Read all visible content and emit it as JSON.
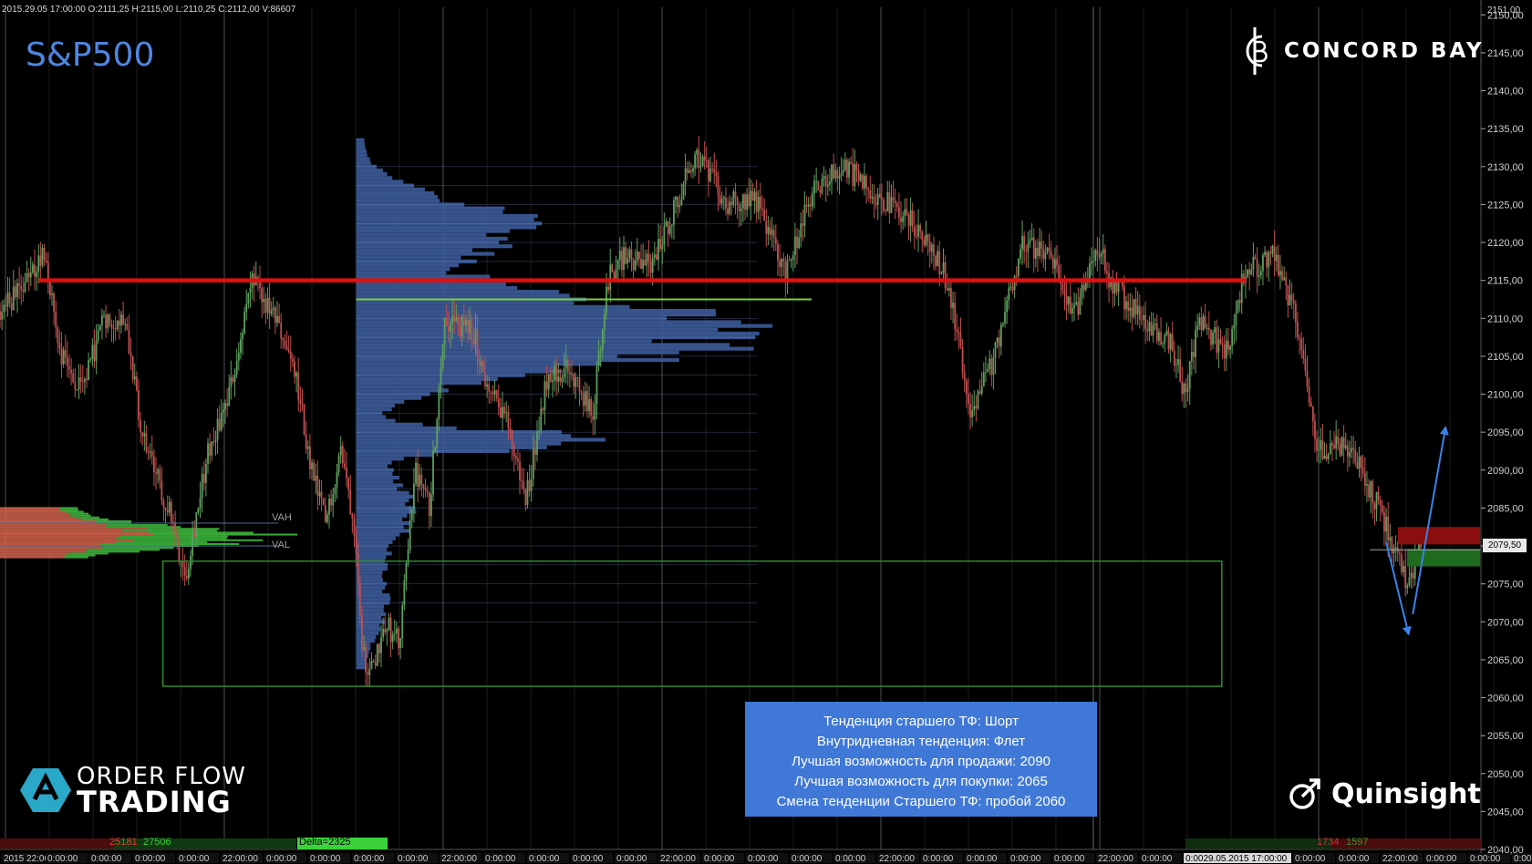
{
  "header": {
    "info_line": "2015.29.05 17:00:00   O:2111,25   H:2115,00   L:2110,25   C:2112,00   V:86607",
    "symbol": "S&P500"
  },
  "brand": {
    "top_right": "CONCORD BAY",
    "bottom_left_top": "ORDER FLOW",
    "bottom_left_bottom": "TRADING",
    "bottom_right": "Quinsight"
  },
  "analysis_box": {
    "lines": [
      "Тенденция старшего ТФ: Шорт",
      "Внутридневная тенденция: Флет",
      "Лучшая возможность для продажи:  2090",
      "Лучшая возможность для покупки:  2065",
      "Смена тенденции Старшего ТФ:  пробой 2060"
    ]
  },
  "price_tag": "2079,50",
  "bottom_stats": {
    "left_red": "25181",
    "left_green": "27506",
    "delta": "Delta=2325",
    "right_red": "1734",
    "right_green": "1597"
  },
  "labels": {
    "vah": "VAH",
    "val": "VAL"
  },
  "colors": {
    "background": "#000000",
    "candle_up": "#5fa05f",
    "candle_down": "#c05050",
    "profile": "#3d5c9a",
    "resistance": "#e01010",
    "poc": "#7ad03a",
    "box": "#2e8c2e",
    "arrow": "#3b82e8",
    "info_box": "#3f78d6",
    "title": "#4f86e0"
  },
  "chart_data": {
    "type": "candlestick",
    "title": "S&P500",
    "ylim": [
      2040,
      2151
    ],
    "y_ticks": [
      "2040,00",
      "2045,00",
      "2050,00",
      "2055,00",
      "2060,00",
      "2065,00",
      "2070,00",
      "2075,00",
      "2080,00",
      "2085,00",
      "2090,00",
      "2095,00",
      "2100,00",
      "2105,00",
      "2110,00",
      "2115,00",
      "2120,00",
      "2125,00",
      "2130,00",
      "2135,00",
      "2140,00",
      "2145,00",
      "2150,00"
    ],
    "top_tick": "2151,00",
    "x_ticks": [
      "2015 22:00:00",
      "0:00:00",
      "0:00:00",
      "0:00:00",
      "0:00:00",
      "22:00:00",
      "0:00:00",
      "0:00:00",
      "0:00:00",
      "0:00:00",
      "22:00:00",
      "0:00:00",
      "0:00:00",
      "0:00:00",
      "0:00:00",
      "22:00:00",
      "0:00:00",
      "0:00:00",
      "0:00:00",
      "0:00:00",
      "22:00:00",
      "0:00:00",
      "0:00:00",
      "0:00:00",
      "0:00:00",
      "22:00:00",
      "0:00:00",
      "0:0029.05.2015 17:00:00",
      "0:00:00",
      "0:00:00",
      "22:00:00",
      "0:00:00",
      "0:00:00",
      "0:00:00",
      "0:00:00",
      "22:00:00",
      "0:00:00"
    ],
    "price_path": [
      [
        0,
        2111
      ],
      [
        0.02,
        2115
      ],
      [
        0.03,
        2119
      ],
      [
        0.04,
        2106
      ],
      [
        0.055,
        2100
      ],
      [
        0.07,
        2110
      ],
      [
        0.085,
        2110
      ],
      [
        0.095,
        2095
      ],
      [
        0.115,
        2084
      ],
      [
        0.125,
        2076
      ],
      [
        0.14,
        2092
      ],
      [
        0.155,
        2100
      ],
      [
        0.17,
        2115
      ],
      [
        0.19,
        2108
      ],
      [
        0.2,
        2102
      ],
      [
        0.21,
        2090
      ],
      [
        0.22,
        2083
      ],
      [
        0.23,
        2093
      ],
      [
        0.24,
        2082
      ],
      [
        0.245,
        2066
      ],
      [
        0.25,
        2063
      ],
      [
        0.26,
        2070
      ],
      [
        0.27,
        2067
      ],
      [
        0.28,
        2090
      ],
      [
        0.29,
        2085
      ],
      [
        0.3,
        2110
      ],
      [
        0.32,
        2108
      ],
      [
        0.33,
        2100
      ],
      [
        0.34,
        2098
      ],
      [
        0.355,
        2086
      ],
      [
        0.37,
        2103
      ],
      [
        0.385,
        2103
      ],
      [
        0.4,
        2097
      ],
      [
        0.41,
        2115
      ],
      [
        0.42,
        2118
      ],
      [
        0.44,
        2117
      ],
      [
        0.47,
        2132
      ],
      [
        0.49,
        2125
      ],
      [
        0.51,
        2126
      ],
      [
        0.53,
        2116
      ],
      [
        0.55,
        2127
      ],
      [
        0.57,
        2130
      ],
      [
        0.6,
        2125
      ],
      [
        0.62,
        2122
      ],
      [
        0.64,
        2115
      ],
      [
        0.655,
        2098
      ],
      [
        0.67,
        2104
      ],
      [
        0.69,
        2120
      ],
      [
        0.71,
        2118
      ],
      [
        0.725,
        2110
      ],
      [
        0.74,
        2120
      ],
      [
        0.75,
        2115
      ],
      [
        0.77,
        2110
      ],
      [
        0.79,
        2107
      ],
      [
        0.8,
        2100
      ],
      [
        0.81,
        2110
      ],
      [
        0.83,
        2105
      ],
      [
        0.84,
        2116
      ],
      [
        0.86,
        2118
      ],
      [
        0.875,
        2110
      ],
      [
        0.89,
        2093
      ],
      [
        0.905,
        2093
      ],
      [
        0.92,
        2090
      ],
      [
        0.935,
        2083
      ],
      [
        0.95,
        2075
      ],
      [
        0.96,
        2080
      ]
    ],
    "annotations": {
      "resistance_level": 2115,
      "poc_level": 2112.5,
      "box": {
        "x0": 0.11,
        "x1": 0.825,
        "y_top": 2078,
        "y_bottom": 2061.5
      },
      "vah": 2083,
      "val": 2080,
      "down_arrow": {
        "from": [
          0.936,
          2080.5
        ],
        "to": [
          0.951,
          2068.5
        ]
      },
      "up_arrow": {
        "from": [
          0.954,
          2071
        ],
        "to": [
          0.976,
          2095.5
        ]
      }
    }
  }
}
